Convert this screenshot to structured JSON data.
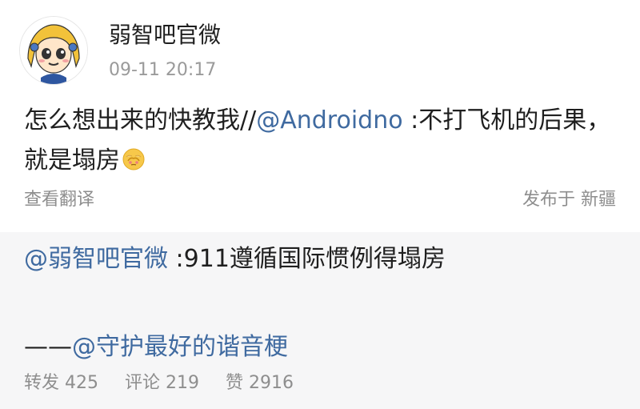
{
  "post": {
    "author": "弱智吧官微",
    "timestamp": "09-11 20:17",
    "content": {
      "part1": "怎么想出来的快教我//",
      "mention": "@Androidno",
      "part2": " :不打飞机的后果，就是塌房",
      "emoji": "sad-face-emoji"
    },
    "translate": "查看翻译",
    "location": "发布于 新疆"
  },
  "repost": {
    "line1": {
      "mention": "@弱智吧官微",
      "text": " :911遵循国际惯例得塌房"
    },
    "line2": {
      "prefix": "——",
      "mention": "@守护最好的谐音梗"
    },
    "stats": {
      "repost": "转发 425",
      "comment": "评论 219",
      "like": "赞 2916"
    }
  },
  "colors": {
    "mention": "#3f6aa0",
    "muted": "#8e8e8e",
    "repost_bg": "#f6f6f7"
  }
}
